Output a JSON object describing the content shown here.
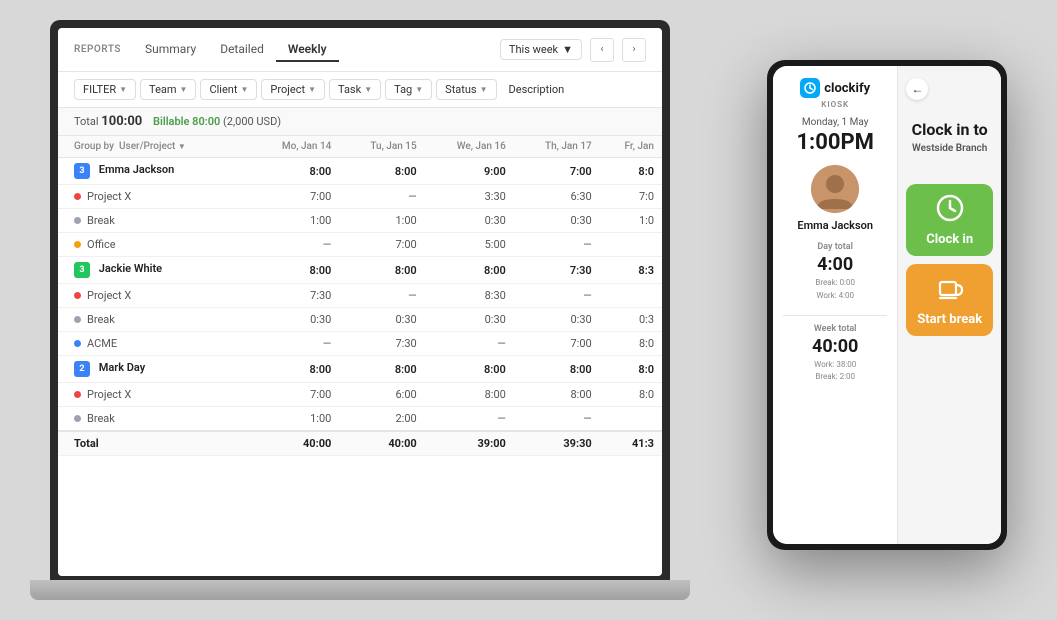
{
  "scene": {
    "bg": "#d8d8d8"
  },
  "app": {
    "reports_label": "REPORTS",
    "tabs": [
      {
        "label": "Summary",
        "active": false
      },
      {
        "label": "Detailed",
        "active": false
      },
      {
        "label": "Weekly",
        "active": true
      }
    ],
    "week_selector": "This week",
    "nav_prev": "‹",
    "nav_next": "›"
  },
  "filters": {
    "items": [
      {
        "label": "FILTER",
        "icon": "▼"
      },
      {
        "label": "Team",
        "icon": "▼"
      },
      {
        "label": "Client",
        "icon": "▼"
      },
      {
        "label": "Project",
        "icon": "▼"
      },
      {
        "label": "Task",
        "icon": "▼"
      },
      {
        "label": "Tag",
        "icon": "▼"
      },
      {
        "label": "Status",
        "icon": "▼"
      },
      {
        "label": "Description",
        "icon": ""
      }
    ]
  },
  "summary": {
    "total_label": "Total",
    "total_value": "100:00",
    "billable_label": "Billable",
    "billable_value": "80:00",
    "billable_amount": "(2,000 USD)"
  },
  "table": {
    "group_by": "User/Project",
    "columns": [
      "Mo, Jan 14",
      "Tu, Jan 15",
      "We, Jan 16",
      "Th, Jan 17",
      "Fr, Jan"
    ],
    "rows": [
      {
        "type": "user",
        "badge": "3",
        "badge_color": "blue",
        "name": "Emma Jackson",
        "days": [
          "8:00",
          "8:00",
          "9:00",
          "7:00",
          "8:0"
        ]
      },
      {
        "type": "project",
        "dot": "red",
        "name": "Project X",
        "days": [
          "7:00",
          "—",
          "3:30",
          "6:30",
          "7:0"
        ]
      },
      {
        "type": "project",
        "dot": "gray",
        "name": "Break",
        "days": [
          "1:00",
          "1:00",
          "0:30",
          "0:30",
          "1:0"
        ]
      },
      {
        "type": "project",
        "dot": "yellow",
        "name": "Office",
        "days": [
          "—",
          "7:00",
          "5:00",
          "—",
          ""
        ]
      },
      {
        "type": "user",
        "badge": "3",
        "badge_color": "green",
        "name": "Jackie White",
        "days": [
          "8:00",
          "8:00",
          "8:00",
          "7:30",
          "8:3"
        ]
      },
      {
        "type": "project",
        "dot": "red",
        "name": "Project X",
        "days": [
          "7:30",
          "—",
          "8:30",
          "—",
          ""
        ]
      },
      {
        "type": "project",
        "dot": "gray",
        "name": "Break",
        "days": [
          "0:30",
          "0:30",
          "0:30",
          "0:30",
          "0:3"
        ]
      },
      {
        "type": "project",
        "dot": "blue",
        "name": "ACME",
        "days": [
          "—",
          "7:30",
          "—",
          "7:00",
          "8:0"
        ]
      },
      {
        "type": "user",
        "badge": "2",
        "badge_color": "blue",
        "name": "Mark Day",
        "days": [
          "8:00",
          "8:00",
          "8:00",
          "8:00",
          "8:0"
        ]
      },
      {
        "type": "project",
        "dot": "red",
        "name": "Project X",
        "days": [
          "7:00",
          "6:00",
          "8:00",
          "8:00",
          "8:0"
        ]
      },
      {
        "type": "project",
        "dot": "gray",
        "name": "Break",
        "days": [
          "1:00",
          "2:00",
          "—",
          "—",
          ""
        ]
      },
      {
        "type": "total",
        "name": "Total",
        "days": [
          "40:00",
          "40:00",
          "39:00",
          "39:30",
          "41:3"
        ]
      }
    ]
  },
  "kiosk": {
    "logo_text": "clockify",
    "kiosk_label": "KIOSK",
    "date": "Monday, 1 May",
    "time": "1:00PM",
    "user_name": "Emma Jackson",
    "day_total_label": "Day total",
    "day_total": "4:00",
    "break_label": "Break: 0:00",
    "work_label": "Work: 4:00",
    "week_total_label": "Week total",
    "week_total": "40:00",
    "week_work_label": "Work: 38:00",
    "week_break_label": "Break: 2:00",
    "back_icon": "←",
    "clock_in_title": "Clock in to",
    "clock_in_subtitle": "Westside Branch",
    "clock_in_btn": "Clock in",
    "start_break_btn": "Start break",
    "clock_icon": "🕐",
    "coffee_icon": "☕"
  }
}
